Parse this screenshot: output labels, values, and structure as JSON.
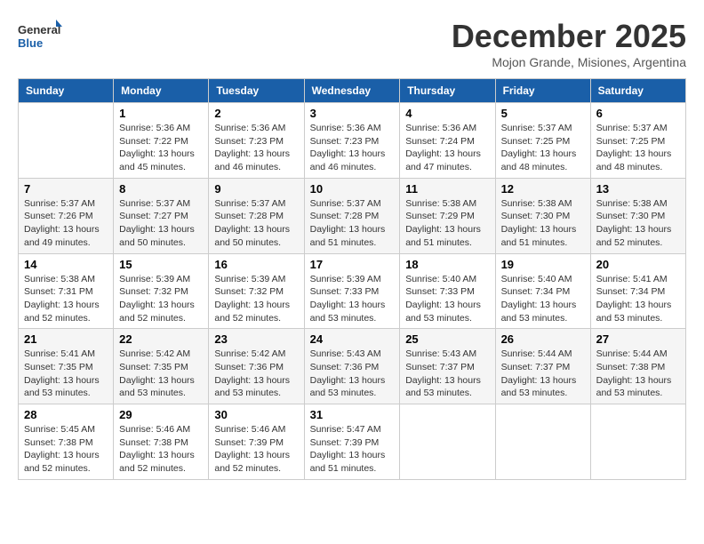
{
  "logo": {
    "line1": "General",
    "line2": "Blue"
  },
  "title": "December 2025",
  "subtitle": "Mojon Grande, Misiones, Argentina",
  "days_of_week": [
    "Sunday",
    "Monday",
    "Tuesday",
    "Wednesday",
    "Thursday",
    "Friday",
    "Saturday"
  ],
  "weeks": [
    [
      {
        "day": "",
        "content": ""
      },
      {
        "day": "1",
        "content": "Sunrise: 5:36 AM\nSunset: 7:22 PM\nDaylight: 13 hours\nand 45 minutes."
      },
      {
        "day": "2",
        "content": "Sunrise: 5:36 AM\nSunset: 7:23 PM\nDaylight: 13 hours\nand 46 minutes."
      },
      {
        "day": "3",
        "content": "Sunrise: 5:36 AM\nSunset: 7:23 PM\nDaylight: 13 hours\nand 46 minutes."
      },
      {
        "day": "4",
        "content": "Sunrise: 5:36 AM\nSunset: 7:24 PM\nDaylight: 13 hours\nand 47 minutes."
      },
      {
        "day": "5",
        "content": "Sunrise: 5:37 AM\nSunset: 7:25 PM\nDaylight: 13 hours\nand 48 minutes."
      },
      {
        "day": "6",
        "content": "Sunrise: 5:37 AM\nSunset: 7:25 PM\nDaylight: 13 hours\nand 48 minutes."
      }
    ],
    [
      {
        "day": "7",
        "content": "Sunrise: 5:37 AM\nSunset: 7:26 PM\nDaylight: 13 hours\nand 49 minutes."
      },
      {
        "day": "8",
        "content": "Sunrise: 5:37 AM\nSunset: 7:27 PM\nDaylight: 13 hours\nand 50 minutes."
      },
      {
        "day": "9",
        "content": "Sunrise: 5:37 AM\nSunset: 7:28 PM\nDaylight: 13 hours\nand 50 minutes."
      },
      {
        "day": "10",
        "content": "Sunrise: 5:37 AM\nSunset: 7:28 PM\nDaylight: 13 hours\nand 51 minutes."
      },
      {
        "day": "11",
        "content": "Sunrise: 5:38 AM\nSunset: 7:29 PM\nDaylight: 13 hours\nand 51 minutes."
      },
      {
        "day": "12",
        "content": "Sunrise: 5:38 AM\nSunset: 7:30 PM\nDaylight: 13 hours\nand 51 minutes."
      },
      {
        "day": "13",
        "content": "Sunrise: 5:38 AM\nSunset: 7:30 PM\nDaylight: 13 hours\nand 52 minutes."
      }
    ],
    [
      {
        "day": "14",
        "content": "Sunrise: 5:38 AM\nSunset: 7:31 PM\nDaylight: 13 hours\nand 52 minutes."
      },
      {
        "day": "15",
        "content": "Sunrise: 5:39 AM\nSunset: 7:32 PM\nDaylight: 13 hours\nand 52 minutes."
      },
      {
        "day": "16",
        "content": "Sunrise: 5:39 AM\nSunset: 7:32 PM\nDaylight: 13 hours\nand 52 minutes."
      },
      {
        "day": "17",
        "content": "Sunrise: 5:39 AM\nSunset: 7:33 PM\nDaylight: 13 hours\nand 53 minutes."
      },
      {
        "day": "18",
        "content": "Sunrise: 5:40 AM\nSunset: 7:33 PM\nDaylight: 13 hours\nand 53 minutes."
      },
      {
        "day": "19",
        "content": "Sunrise: 5:40 AM\nSunset: 7:34 PM\nDaylight: 13 hours\nand 53 minutes."
      },
      {
        "day": "20",
        "content": "Sunrise: 5:41 AM\nSunset: 7:34 PM\nDaylight: 13 hours\nand 53 minutes."
      }
    ],
    [
      {
        "day": "21",
        "content": "Sunrise: 5:41 AM\nSunset: 7:35 PM\nDaylight: 13 hours\nand 53 minutes."
      },
      {
        "day": "22",
        "content": "Sunrise: 5:42 AM\nSunset: 7:35 PM\nDaylight: 13 hours\nand 53 minutes."
      },
      {
        "day": "23",
        "content": "Sunrise: 5:42 AM\nSunset: 7:36 PM\nDaylight: 13 hours\nand 53 minutes."
      },
      {
        "day": "24",
        "content": "Sunrise: 5:43 AM\nSunset: 7:36 PM\nDaylight: 13 hours\nand 53 minutes."
      },
      {
        "day": "25",
        "content": "Sunrise: 5:43 AM\nSunset: 7:37 PM\nDaylight: 13 hours\nand 53 minutes."
      },
      {
        "day": "26",
        "content": "Sunrise: 5:44 AM\nSunset: 7:37 PM\nDaylight: 13 hours\nand 53 minutes."
      },
      {
        "day": "27",
        "content": "Sunrise: 5:44 AM\nSunset: 7:38 PM\nDaylight: 13 hours\nand 53 minutes."
      }
    ],
    [
      {
        "day": "28",
        "content": "Sunrise: 5:45 AM\nSunset: 7:38 PM\nDaylight: 13 hours\nand 52 minutes."
      },
      {
        "day": "29",
        "content": "Sunrise: 5:46 AM\nSunset: 7:38 PM\nDaylight: 13 hours\nand 52 minutes."
      },
      {
        "day": "30",
        "content": "Sunrise: 5:46 AM\nSunset: 7:39 PM\nDaylight: 13 hours\nand 52 minutes."
      },
      {
        "day": "31",
        "content": "Sunrise: 5:47 AM\nSunset: 7:39 PM\nDaylight: 13 hours\nand 51 minutes."
      },
      {
        "day": "",
        "content": ""
      },
      {
        "day": "",
        "content": ""
      },
      {
        "day": "",
        "content": ""
      }
    ]
  ]
}
